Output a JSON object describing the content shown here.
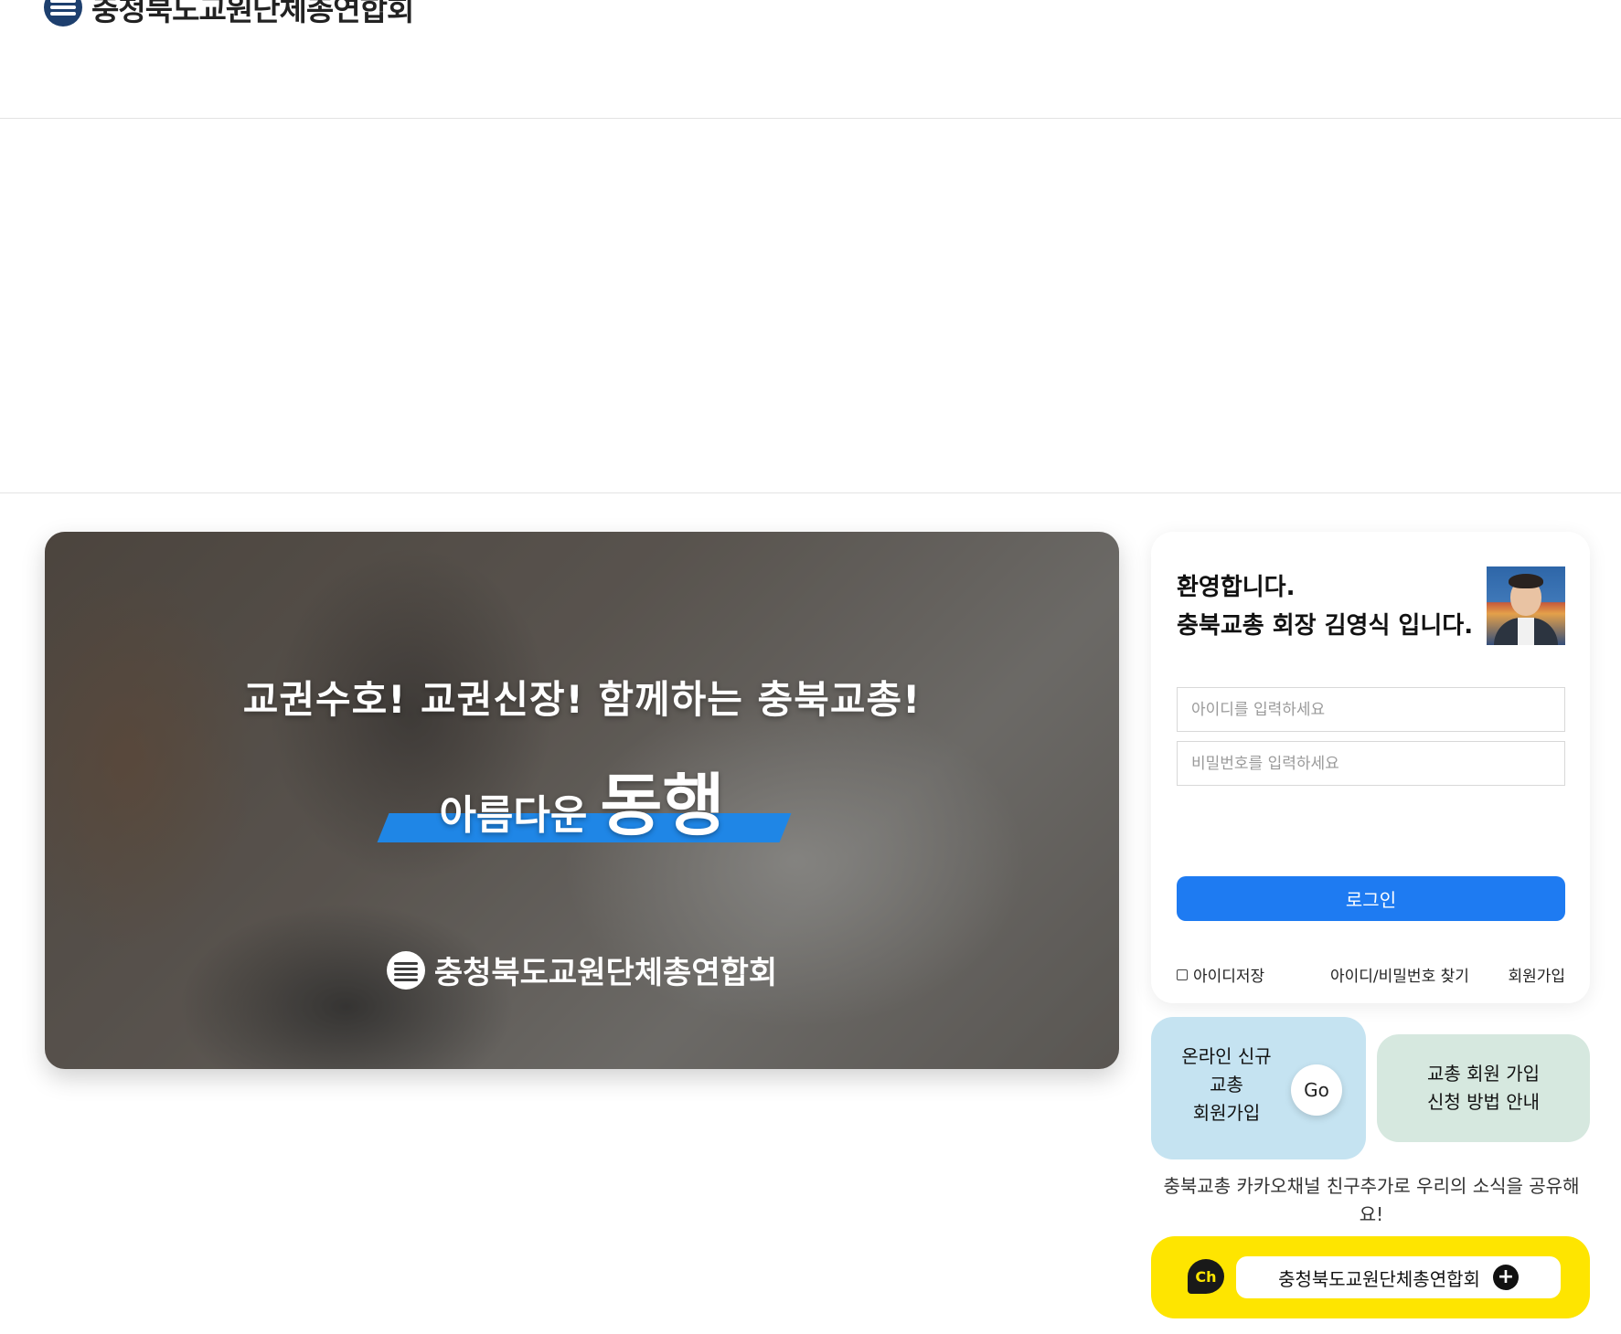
{
  "header": {
    "logo_text": "충청북도교원단체총연합회"
  },
  "banner": {
    "slogan": "교권수호!  교권신장!  함께하는 충북교총!",
    "sub_small": "아름다운",
    "sub_big": "동행",
    "logo_text": "충청북도교원단체총연합회",
    "highlight_color": "#1f86e6"
  },
  "login": {
    "welcome_line1": "환영합니다.",
    "welcome_line2": "충북교총 회장 김영식 입니다.",
    "id_placeholder": "아이디를 입력하세요",
    "pw_placeholder": "비밀번호를 입력하세요",
    "login_button": "로그인",
    "save_id_label": "아이디저장",
    "find_link": "아이디/비밀번호 찾기",
    "join_link": "회원가입",
    "button_color": "#1e7bf2"
  },
  "tiles": {
    "join_line1": "온라인 신규",
    "join_line2": "교총",
    "join_line3": "회원가입",
    "go_label": "Go",
    "guide_line1": "교총 회원 가입",
    "guide_line2": "신청 방법 안내"
  },
  "kakao": {
    "notice": "충북교총 카카오채널 친구추가로 우리의 소식을 공유해요!",
    "ch_label": "Ch",
    "channel_name": "충청북도교원단체총연합회",
    "plus_label": "+",
    "bar_color": "#fee500"
  }
}
